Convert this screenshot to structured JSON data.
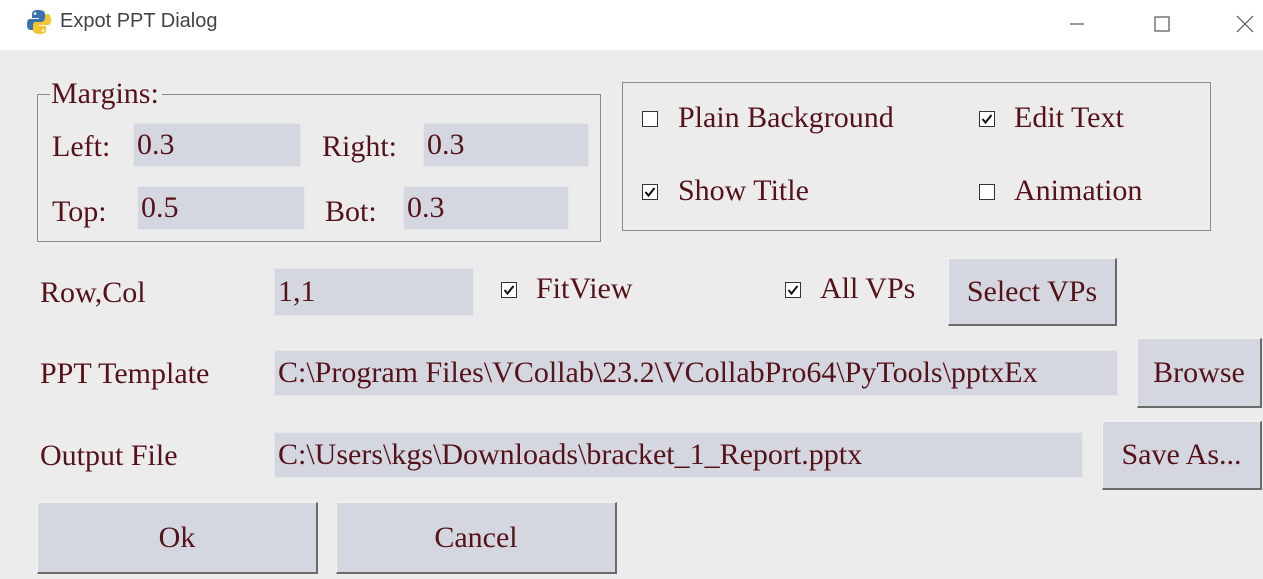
{
  "window": {
    "title": "Expot PPT Dialog"
  },
  "margins": {
    "legend": "Margins:",
    "left_label": "Left:",
    "left_value": "0.3",
    "right_label": "Right:",
    "right_value": "0.3",
    "top_label": "Top:",
    "top_value": "0.5",
    "bot_label": "Bot:",
    "bot_value": "0.3"
  },
  "options": {
    "plain_background": {
      "label": "Plain Background",
      "checked": false
    },
    "edit_text": {
      "label": "Edit Text",
      "checked": true
    },
    "show_title": {
      "label": "Show Title",
      "checked": true
    },
    "animation": {
      "label": "Animation",
      "checked": false
    }
  },
  "rowcol": {
    "label": "Row,Col",
    "value": "1,1",
    "fitview": {
      "label": "FitView",
      "checked": true
    },
    "all_vps": {
      "label": "All VPs",
      "checked": true
    },
    "select_vps_label": "Select VPs"
  },
  "template": {
    "label": "PPT Template",
    "value": "C:\\Program Files\\VCollab\\23.2\\VCollabPro64\\PyTools\\pptxEx",
    "browse_label": "Browse"
  },
  "output": {
    "label": "Output File",
    "value": "C:\\Users\\kgs\\Downloads\\bracket_1_Report.pptx",
    "save_as_label": "Save As..."
  },
  "actions": {
    "ok_label": "Ok",
    "cancel_label": "Cancel"
  }
}
